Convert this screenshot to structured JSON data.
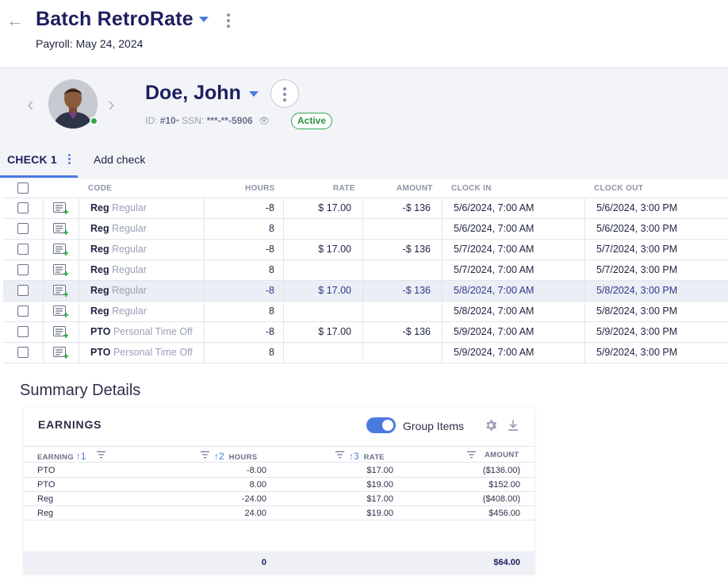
{
  "header": {
    "title": "Batch RetroRate",
    "subtitle": "Payroll: May 24, 2024"
  },
  "employee": {
    "name": "Doe, John",
    "id_label": "ID:",
    "id_value": "#10",
    "ssn_label": "SSN:",
    "ssn_value": "***-**-5906",
    "status": "Active"
  },
  "tabs": {
    "check": "CHECK 1",
    "add": "Add check"
  },
  "grid": {
    "columns": {
      "code": "CODE",
      "hours": "HOURS",
      "rate": "RATE",
      "amount": "AMOUNT",
      "clock_in": "CLOCK IN",
      "clock_out": "CLOCK OUT"
    },
    "rows": [
      {
        "code": "Reg",
        "desc": "Regular",
        "hours": "-8",
        "rate": "$ 17.00",
        "amount": "-$ 136",
        "clock_in": "5/6/2024, 7:00 AM",
        "clock_out": "5/6/2024, 3:00 PM"
      },
      {
        "code": "Reg",
        "desc": "Regular",
        "hours": "8",
        "rate": "",
        "amount": "",
        "clock_in": "5/6/2024, 7:00 AM",
        "clock_out": "5/6/2024, 3:00 PM"
      },
      {
        "code": "Reg",
        "desc": "Regular",
        "hours": "-8",
        "rate": "$ 17.00",
        "amount": "-$ 136",
        "clock_in": "5/7/2024, 7:00 AM",
        "clock_out": "5/7/2024, 3:00 PM"
      },
      {
        "code": "Reg",
        "desc": "Regular",
        "hours": "8",
        "rate": "",
        "amount": "",
        "clock_in": "5/7/2024, 7:00 AM",
        "clock_out": "5/7/2024, 3:00 PM"
      },
      {
        "code": "Reg",
        "desc": "Regular",
        "hours": "-8",
        "rate": "$ 17.00",
        "amount": "-$ 136",
        "clock_in": "5/8/2024, 7:00 AM",
        "clock_out": "5/8/2024, 3:00 PM"
      },
      {
        "code": "Reg",
        "desc": "Regular",
        "hours": "8",
        "rate": "",
        "amount": "",
        "clock_in": "5/8/2024, 7:00 AM",
        "clock_out": "5/8/2024, 3:00 PM"
      },
      {
        "code": "PTO",
        "desc": "Personal Time Off",
        "hours": "-8",
        "rate": "$ 17.00",
        "amount": "-$ 136",
        "clock_in": "5/9/2024, 7:00 AM",
        "clock_out": "5/9/2024, 3:00 PM"
      },
      {
        "code": "PTO",
        "desc": "Personal Time Off",
        "hours": "8",
        "rate": "",
        "amount": "",
        "clock_in": "5/9/2024, 7:00 AM",
        "clock_out": "5/9/2024, 3:00 PM"
      }
    ]
  },
  "summary": {
    "title": "Summary Details",
    "card_title": "EARNINGS",
    "toggle_label": "Group Items",
    "columns": {
      "earning": "EARNING",
      "earning_sort": "1",
      "hours": "HOURS",
      "hours_sort": "2",
      "rate": "RATE",
      "rate_sort": "3",
      "amount": "AMOUNT"
    },
    "rows": [
      {
        "earning": "PTO",
        "hours": "-8.00",
        "rate": "$17.00",
        "amount": "($136.00)"
      },
      {
        "earning": "PTO",
        "hours": "8.00",
        "rate": "$19.00",
        "amount": "$152.00"
      },
      {
        "earning": "Reg",
        "hours": "-24.00",
        "rate": "$17.00",
        "amount": "($408.00)"
      },
      {
        "earning": "Reg",
        "hours": "24.00",
        "rate": "$19.00",
        "amount": "$456.00"
      }
    ],
    "totals": {
      "hours": "0",
      "amount": "$64.00"
    }
  },
  "colors": {
    "accent": "#4a7ae0",
    "title": "#1c1f5e",
    "active_green": "#2fa84f"
  }
}
